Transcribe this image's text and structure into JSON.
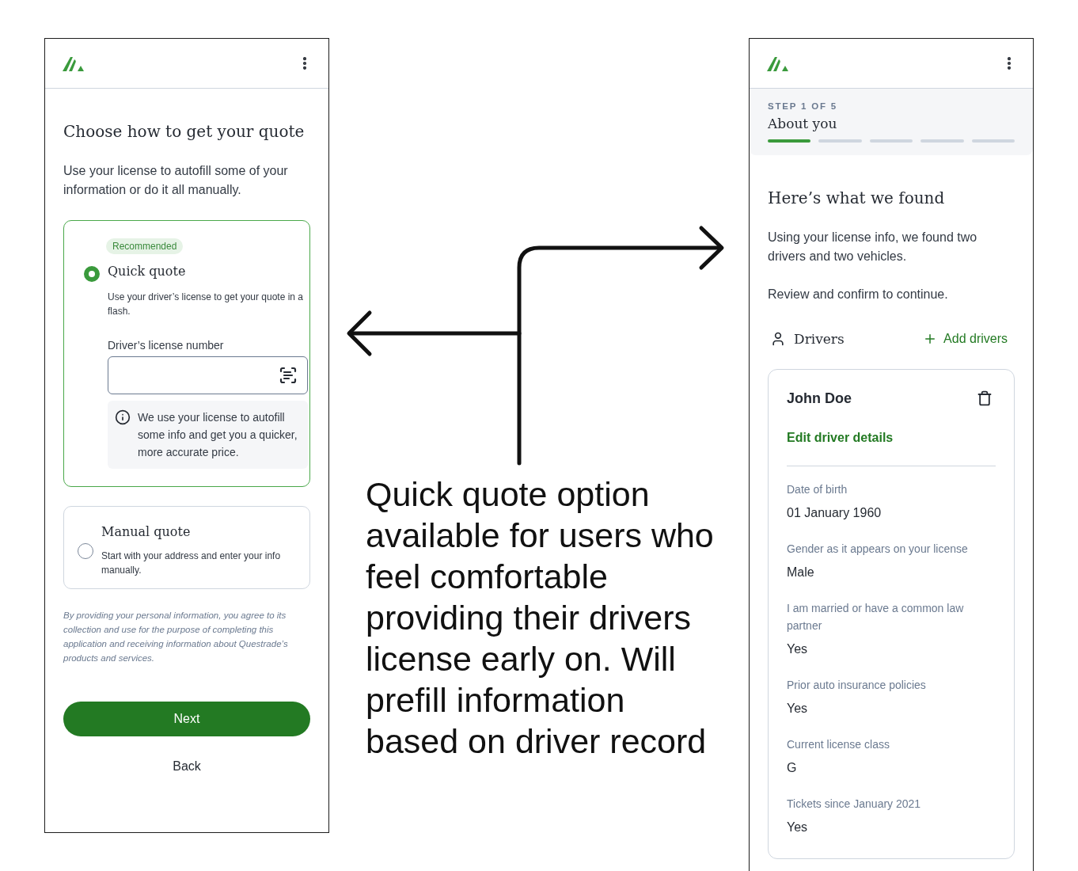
{
  "quote_method_screen": {
    "title": "Choose how to get your quote",
    "intro": "Use your license to autofill some of your information or do it all manually.",
    "options": [
      {
        "badge": "Recommended",
        "title": "Quick quote",
        "description": "Use your driver’s license to get your quote in a flash.",
        "selected": true,
        "field": {
          "label": "Driver’s license number"
        },
        "note": "We use your license to autofill some info and get you a quicker, more accurate price."
      },
      {
        "title": "Manual quote",
        "description": "Start with your address and enter your info manually.",
        "selected": false
      }
    ],
    "disclaimer": "By providing your personal information, you agree to its collection and use for the purpose of completing this application and receiving information about Questrade’s products and services.",
    "buttons": [
      {
        "label": "Next",
        "kind": "primary"
      },
      {
        "label": "Back",
        "kind": "text"
      }
    ]
  },
  "annotation": {
    "text": "Quick quote option available for users who feel comfortable providing their drivers license early on. Will prefill information based on driver record"
  },
  "review_screen": {
    "step": {
      "label": "STEP 1 OF 5",
      "title": "About you",
      "segments": [
        {
          "done": true
        },
        {
          "done": false
        },
        {
          "done": false
        },
        {
          "done": false
        },
        {
          "done": false
        }
      ]
    },
    "title": "Here’s what we found",
    "paragraphs": [
      "Using your license info, we found two drivers and two vehicles.",
      "Review and confirm to continue."
    ],
    "section": {
      "title": "Drivers",
      "action": "Add drivers"
    },
    "driver": {
      "name": "John Doe",
      "edit": "Edit driver details",
      "details": [
        {
          "label": "Date of birth",
          "value": "01 January 1960"
        },
        {
          "label": "Gender as it appears on your license",
          "value": "Male"
        },
        {
          "label": "I am married or have a common law partner",
          "value": "Yes"
        },
        {
          "label": "Prior auto insurance policies",
          "value": "Yes"
        },
        {
          "label": "Current license class",
          "value": "G"
        },
        {
          "label": "Tickets since January 2021",
          "value": "Yes"
        }
      ]
    }
  }
}
